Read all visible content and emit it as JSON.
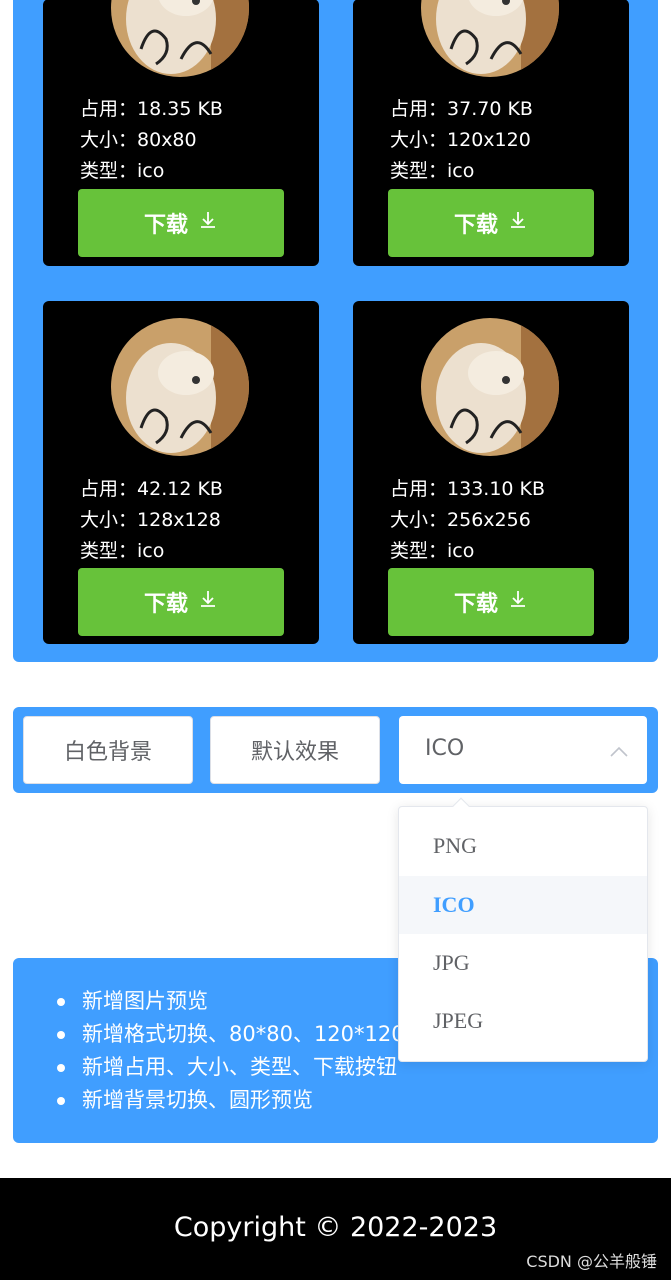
{
  "cards": [
    {
      "usage_label": "占用：",
      "usage": "18.35 KB",
      "size_label": "大小：",
      "size": "80x80",
      "type_label": "类型：",
      "type": "ico",
      "download_label": "下载"
    },
    {
      "usage_label": "占用：",
      "usage": "37.70 KB",
      "size_label": "大小：",
      "size": "120x120",
      "type_label": "类型：",
      "type": "ico",
      "download_label": "下载"
    },
    {
      "usage_label": "占用：",
      "usage": "42.12 KB",
      "size_label": "大小：",
      "size": "128x128",
      "type_label": "类型：",
      "type": "ico",
      "download_label": "下载"
    },
    {
      "usage_label": "占用：",
      "usage": "133.10 KB",
      "size_label": "大小：",
      "size": "256x256",
      "type_label": "类型：",
      "type": "ico",
      "download_label": "下载"
    }
  ],
  "toolbar": {
    "white_bg_label": "白色背景",
    "default_effect_label": "默认效果",
    "format_select_value": "ICO"
  },
  "format_options": [
    "PNG",
    "ICO",
    "JPG",
    "JPEG"
  ],
  "format_selected": "ICO",
  "notes": [
    "新增图片预览",
    "新增格式切换、80*80、120*120",
    "新增占用、大小、类型、下载按钮",
    "新增背景切换、圆形预览"
  ],
  "footer": {
    "copyright": "Copyright © 2022-2023"
  },
  "watermark": "CSDN @公羊般锤",
  "colors": {
    "primary": "#409eff",
    "success": "#67c23a",
    "card_bg": "#000000"
  },
  "icons": {
    "download": "download-icon",
    "select_toggle": "chevron-up-icon"
  }
}
